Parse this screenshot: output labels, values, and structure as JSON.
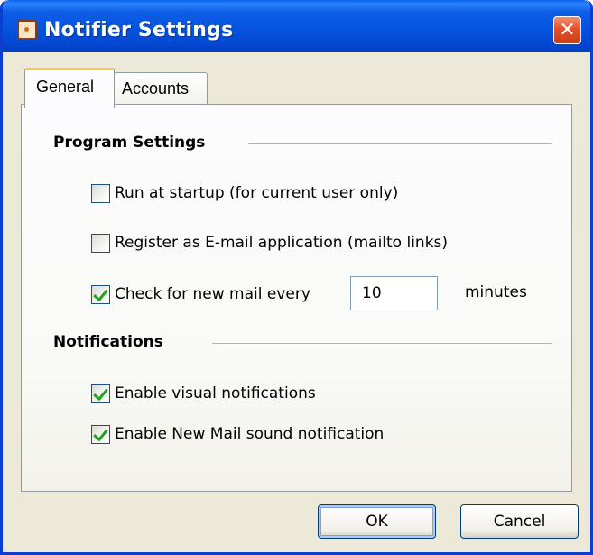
{
  "window": {
    "title": "Notifier Settings",
    "close_glyph": "✕",
    "app_icon": "notifier-app-icon"
  },
  "tabs": [
    {
      "label": "General",
      "selected": true
    },
    {
      "label": "Accounts",
      "selected": false
    }
  ],
  "program_settings": {
    "heading": "Program Settings",
    "run_at_startup": {
      "label": "Run at startup (for current user only)",
      "checked": false
    },
    "register_mailto": {
      "label": "Register as E-mail application (mailto links)",
      "checked": false
    },
    "check_mail": {
      "label": "Check for new mail every",
      "checked": true,
      "interval_value": "10",
      "unit": "minutes"
    }
  },
  "notifications": {
    "heading": "Notifications",
    "visual": {
      "label": "Enable visual notifications",
      "checked": true
    },
    "sound": {
      "label": "Enable New Mail sound notification",
      "checked": true
    }
  },
  "buttons": {
    "ok_label": "OK",
    "cancel_label": "Cancel"
  },
  "colors": {
    "titlebar_blue": "#0653de",
    "window_face": "#ece9d8",
    "close_red": "#e2512b",
    "check_green": "#21a121",
    "tab_highlight": "#ffc83c"
  }
}
